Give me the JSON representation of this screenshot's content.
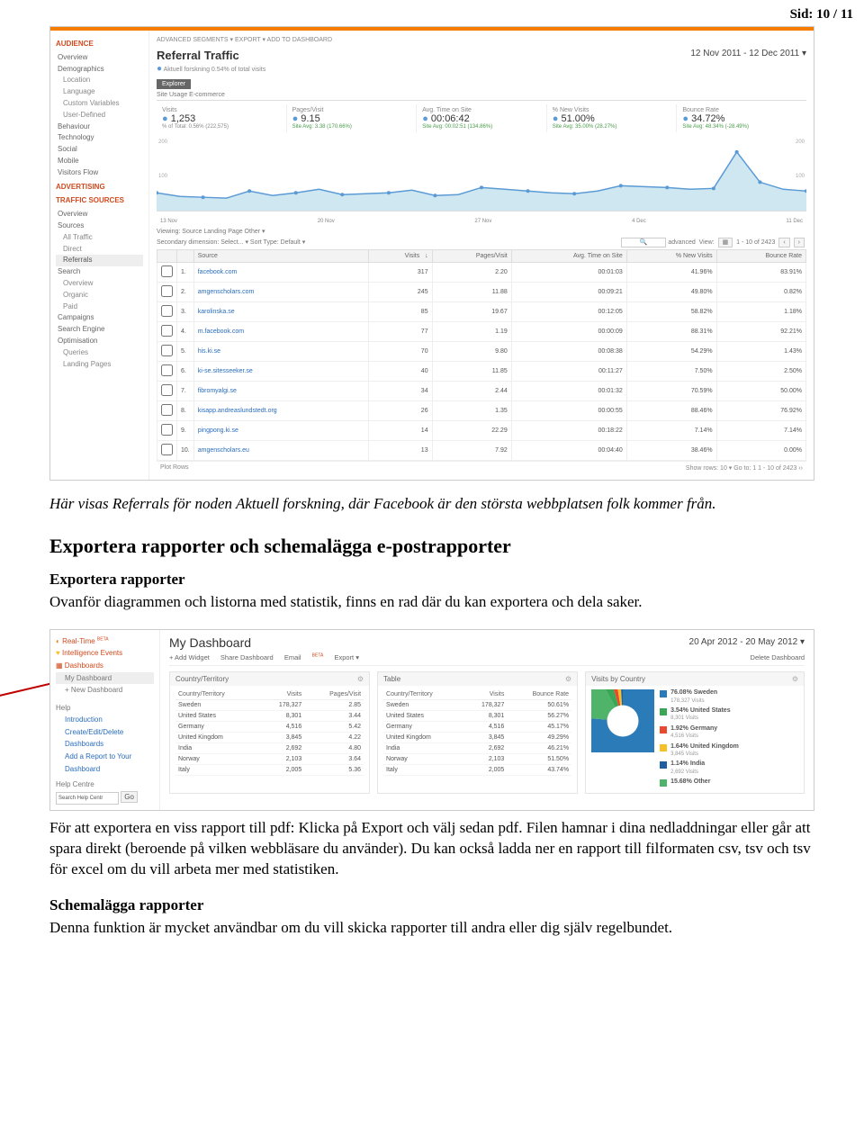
{
  "page_number": "Sid: 10 / 11",
  "caption1": "Här visas Referrals för noden Aktuell forskning, där Facebook är den största webbplatsen folk kommer från.",
  "section_heading": "Exportera rapporter och schemalägga e-postrapporter",
  "subhead1": "Exportera rapporter",
  "para1": "Ovanför diagrammen och listorna med statistik, finns en rad där du kan exportera och dela saker.",
  "para2": "För att exportera en viss rapport till pdf: Klicka på Export och välj sedan pdf. Filen hamnar i dina nedladdningar eller går att spara direkt (beroende på vilken webbläsare du använder). Du kan också ladda ner en rapport till filformaten csv, tsv och tsv för excel om du vill arbeta mer med statistiken.",
  "subhead2": "Schemalägga rapporter",
  "para3": "Denna funktion är mycket användbar om du vill skicka rapporter till andra eller dig själv regelbundet.",
  "ga1": {
    "toolbar": "ADVANCED SEGMENTS ▾    EXPORT ▾    ADD TO DASHBOARD",
    "title": "Referral Traffic",
    "subtitle_label": "Aktuell forskning",
    "subtitle_note": "0.54% of total visits",
    "date": "12 Nov 2011 - 12 Dec 2011",
    "explorer": "Explorer",
    "tabs": "Site Usage    E-commerce",
    "sidebar": {
      "sec1": "AUDIENCE",
      "s1_items": [
        "Overview",
        "Demographics",
        "Location",
        "Language",
        "Custom Variables",
        "User-Defined",
        "Behaviour",
        "Technology",
        "Social",
        "Mobile",
        "Visitors Flow"
      ],
      "sec2": "ADVERTISING",
      "sec3": "TRAFFIC SOURCES",
      "s3_items": [
        "Overview",
        "Sources",
        "All Traffic",
        "Direct",
        "Referrals",
        "Search",
        "Overview",
        "Organic",
        "Paid",
        "Campaigns",
        "Search Engine Optimisation",
        "Queries",
        "Landing Pages"
      ]
    },
    "metrics": [
      {
        "label": "Visits",
        "value": "1,253",
        "sub": "% of Total: 0.56% (222,575)"
      },
      {
        "label": "Pages/Visit",
        "value": "9.15",
        "sub": "Site Avg: 3.38 (170.66%)",
        "green": true
      },
      {
        "label": "Avg. Time on Site",
        "value": "00:06:42",
        "sub": "Site Avg: 00:02:51 (134.86%)",
        "green": true
      },
      {
        "label": "% New Visits",
        "value": "51.00%",
        "sub": "Site Avg: 35.00% (28.27%)",
        "green": true
      },
      {
        "label": "Bounce Rate",
        "value": "34.72%",
        "sub": "Site Avg: 48.34% (-28.49%)",
        "green": true
      }
    ],
    "chart_axis": [
      "13 Nov",
      "20 Nov",
      "27 Nov",
      "4 Dec",
      "11 Dec"
    ],
    "chart_y_top": "200",
    "chart_y_bot": "100",
    "viewing": "Viewing:  Source  Landing Page  Other ▾",
    "secondary_dim": "Secondary dimension:  Select... ▾    Sort Type:  Default ▾",
    "advanced": "advanced",
    "view_label": "View:",
    "page_range": "1 - 10 of 2423",
    "columns": [
      "",
      "",
      "Source",
      "Visits",
      "↓",
      "Pages/Visit",
      "Avg. Time on Site",
      "% New Visits",
      "Bounce Rate"
    ],
    "rows": [
      {
        "n": "1.",
        "src": "facebook.com",
        "v": "317",
        "pv": "2.20",
        "t": "00:01:03",
        "nv": "41.96%",
        "br": "83.91%"
      },
      {
        "n": "2.",
        "src": "amgenscholars.com",
        "v": "245",
        "pv": "11.88",
        "t": "00:09:21",
        "nv": "49.80%",
        "br": "0.82%"
      },
      {
        "n": "3.",
        "src": "karolinska.se",
        "v": "85",
        "pv": "19.67",
        "t": "00:12:05",
        "nv": "58.82%",
        "br": "1.18%"
      },
      {
        "n": "4.",
        "src": "m.facebook.com",
        "v": "77",
        "pv": "1.19",
        "t": "00:00:09",
        "nv": "88.31%",
        "br": "92.21%"
      },
      {
        "n": "5.",
        "src": "his.ki.se",
        "v": "70",
        "pv": "9.80",
        "t": "00:08:38",
        "nv": "54.29%",
        "br": "1.43%"
      },
      {
        "n": "6.",
        "src": "ki-se.sitesseeker.se",
        "v": "40",
        "pv": "11.85",
        "t": "00:11:27",
        "nv": "7.50%",
        "br": "2.50%"
      },
      {
        "n": "7.",
        "src": "fibromyalgi.se",
        "v": "34",
        "pv": "2.44",
        "t": "00:01:32",
        "nv": "70.59%",
        "br": "50.00%"
      },
      {
        "n": "8.",
        "src": "kisapp.andreaslundstedt.org",
        "v": "26",
        "pv": "1.35",
        "t": "00:00:55",
        "nv": "88.46%",
        "br": "76.92%"
      },
      {
        "n": "9.",
        "src": "pingpong.ki.se",
        "v": "14",
        "pv": "22.29",
        "t": "00:18:22",
        "nv": "7.14%",
        "br": "7.14%"
      },
      {
        "n": "10.",
        "src": "amgenscholars.eu",
        "v": "13",
        "pv": "7.92",
        "t": "00:04:40",
        "nv": "38.46%",
        "br": "0.00%"
      }
    ],
    "plot_rows": "Plot Rows",
    "show_rows": "Show rows:",
    "show_rows_n": "10",
    "goto": "Go to:",
    "goto_n": "1",
    "footer_range": "1 - 10 of 2423"
  },
  "chart_data": {
    "type": "line",
    "title": "Referral Traffic — Aktuell forskning",
    "x": [
      "13 Nov",
      "20 Nov",
      "27 Nov",
      "4 Dec",
      "11 Dec"
    ],
    "ylim": [
      0,
      200
    ],
    "series": [
      {
        "name": "Visits",
        "values": [
          40,
          32,
          30,
          28,
          45,
          35,
          42,
          50,
          38,
          40,
          42,
          48,
          36,
          38,
          55,
          50,
          45,
          42,
          40,
          45,
          60,
          58,
          55,
          50,
          52,
          165,
          70,
          50,
          45
        ]
      }
    ]
  },
  "ga2": {
    "sidebar": {
      "realtime": "Real-Time",
      "beta": "BETA",
      "intel": "Intelligence Events",
      "dash": "Dashboards",
      "mydash": "My Dashboard",
      "newdash": "+ New Dashboard",
      "help": "Help",
      "intro": "Introduction",
      "cred": "Create/Edit/Delete Dashboards",
      "addrep": "Add a Report to Your Dashboard",
      "helpc": "Help Centre",
      "search_ph": "Search Help Centr",
      "go": "Go"
    },
    "title": "My Dashboard",
    "date": "20 Apr 2012 - 20 May 2012",
    "toolbar": {
      "add": "+ Add Widget",
      "share": "Share Dashboard",
      "email": "Email",
      "beta": "BETA",
      "export": "Export ▾",
      "delete": "Delete Dashboard"
    },
    "widget1": {
      "title": "Country/Territory",
      "cols": [
        "Country/Territory",
        "Visits",
        "Pages/Visit"
      ],
      "rows": [
        {
          "c": "Sweden",
          "v": "178,327",
          "p": "2.85"
        },
        {
          "c": "United States",
          "v": "8,301",
          "p": "3.44"
        },
        {
          "c": "Germany",
          "v": "4,516",
          "p": "5.42"
        },
        {
          "c": "United Kingdom",
          "v": "3,845",
          "p": "4.22"
        },
        {
          "c": "India",
          "v": "2,692",
          "p": "4.80"
        },
        {
          "c": "Norway",
          "v": "2,103",
          "p": "3.64"
        },
        {
          "c": "Italy",
          "v": "2,005",
          "p": "5.36"
        }
      ]
    },
    "widget2": {
      "title": "Table",
      "cols": [
        "Country/Territory",
        "Visits",
        "Bounce Rate"
      ],
      "rows": [
        {
          "c": "Sweden",
          "v": "178,327",
          "b": "50.61%"
        },
        {
          "c": "United States",
          "v": "8,301",
          "b": "56.27%"
        },
        {
          "c": "Germany",
          "v": "4,516",
          "b": "45.17%"
        },
        {
          "c": "United Kingdom",
          "v": "3,845",
          "b": "49.29%"
        },
        {
          "c": "India",
          "v": "2,692",
          "b": "46.21%"
        },
        {
          "c": "Norway",
          "v": "2,103",
          "b": "51.50%"
        },
        {
          "c": "Italy",
          "v": "2,005",
          "b": "43.74%"
        }
      ]
    },
    "widget3": {
      "title": "Visits by Country",
      "legend": [
        {
          "color": "#2b7bb9",
          "pct": "76.08% Sweden",
          "sub": "178,327 Visits"
        },
        {
          "color": "#3aa757",
          "pct": "3.54% United States",
          "sub": "8,301 Visits"
        },
        {
          "color": "#e8492f",
          "pct": "1.92% Germany",
          "sub": "4,516 Visits"
        },
        {
          "color": "#f8c027",
          "pct": "1.64% United Kingdom",
          "sub": "3,845 Visits"
        },
        {
          "color": "#1e5fa0",
          "pct": "1.14% India",
          "sub": "2,692 Visits"
        },
        {
          "color": "#4fb36a",
          "pct": "15.68% Other",
          "sub": ""
        }
      ]
    }
  }
}
